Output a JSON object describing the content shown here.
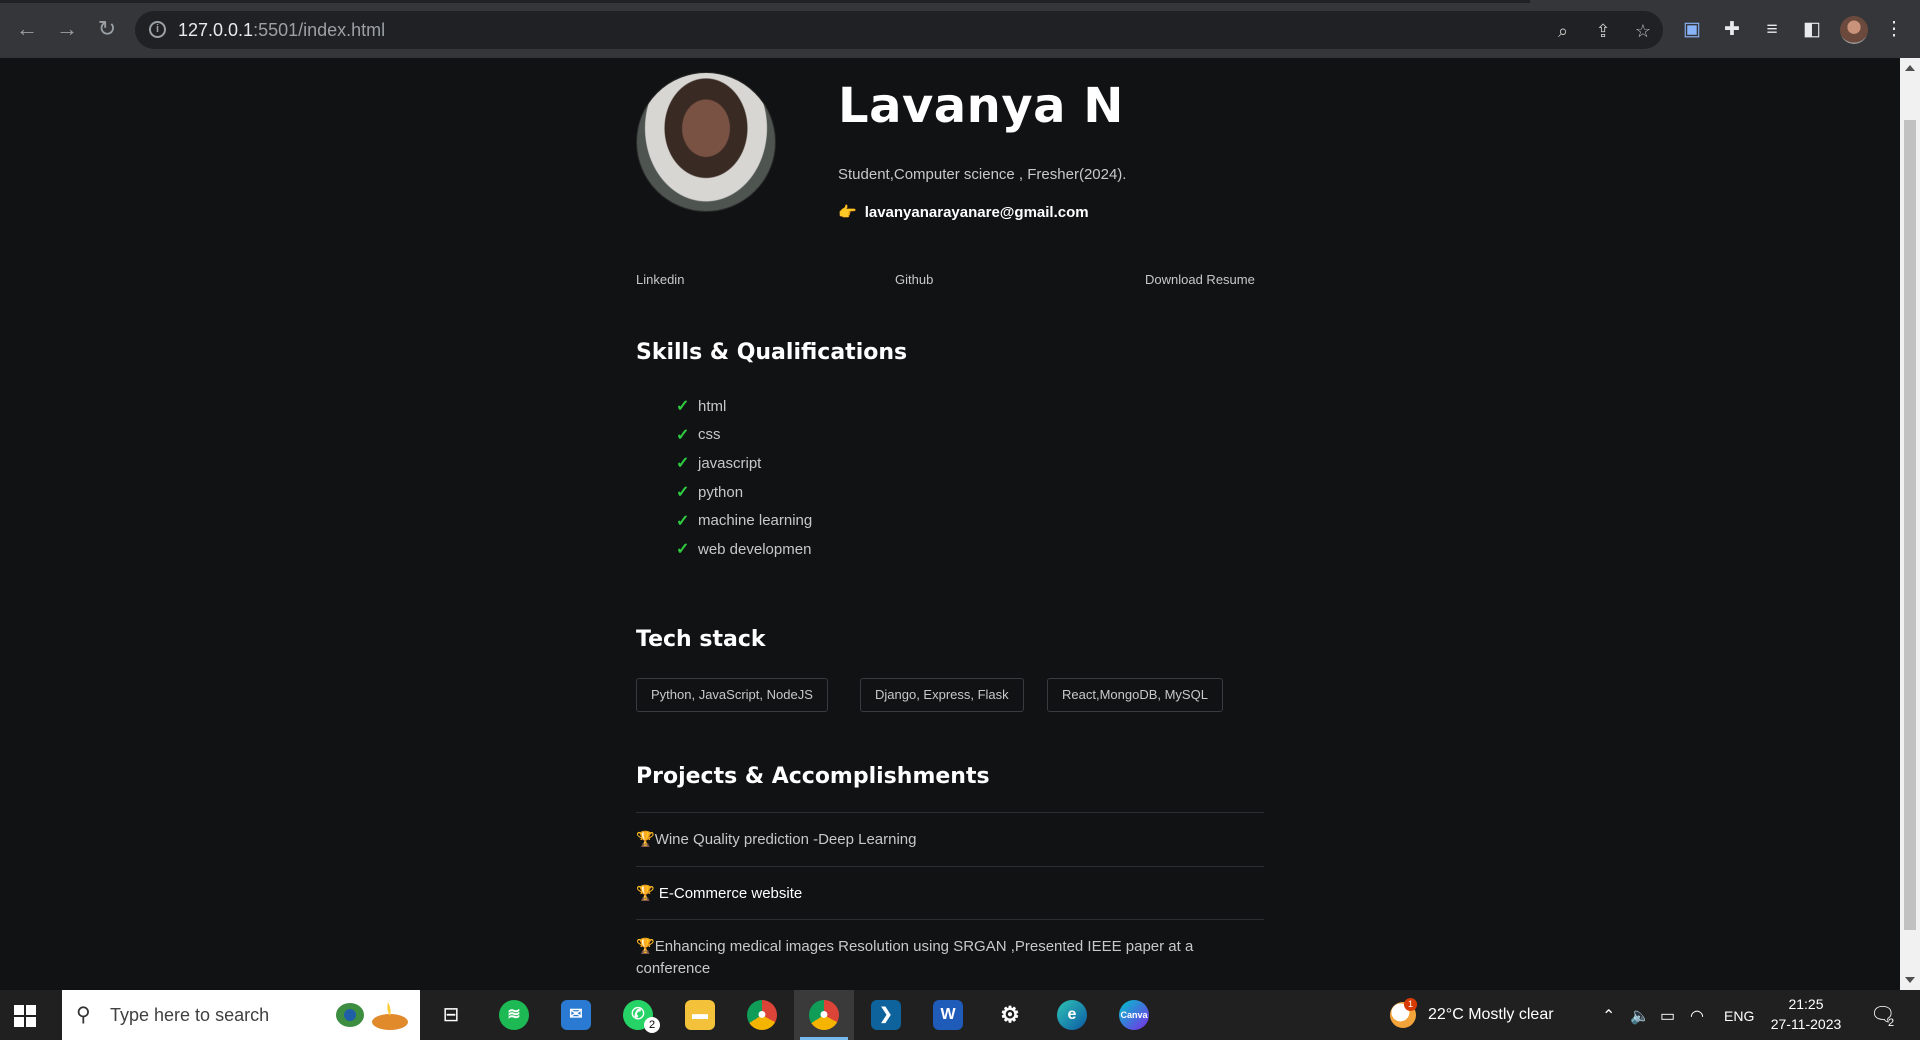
{
  "browser": {
    "url_host": "127.0.0.1",
    "url_rest": ":5501/index.html"
  },
  "profile": {
    "name": "Lavanya N",
    "tagline": "Student,Computer science , Fresher(2024).",
    "email": "lavanyanarayanare@gmail.com",
    "email_icon": "👉"
  },
  "links": [
    "Linkedin",
    "Github",
    "Download Resume"
  ],
  "skills": {
    "heading": "Skills & Qualifications",
    "items": [
      "html",
      "css",
      "javascript",
      "python",
      "machine learning",
      "web developmen"
    ]
  },
  "tech": {
    "heading": "Tech stack",
    "chips": [
      "Python, JavaScript, NodeJS",
      "Django, Express, Flask",
      "React,MongoDB, MySQL"
    ]
  },
  "projects": {
    "heading": "Projects & Accomplishments",
    "items": [
      "Wine Quality prediction -Deep Learning",
      "E-Commerce website",
      "Enhancing medical images Resolution using SRGAN ,Presented IEEE paper at a conference"
    ]
  },
  "taskbar": {
    "search_placeholder": "Type here to search",
    "whatsapp_badge": "2",
    "weather_badge": "1",
    "weather": "22°C  Mostly clear",
    "language": "ENG",
    "time": "21:25",
    "date": "27-11-2023",
    "notification_badge": "2"
  }
}
